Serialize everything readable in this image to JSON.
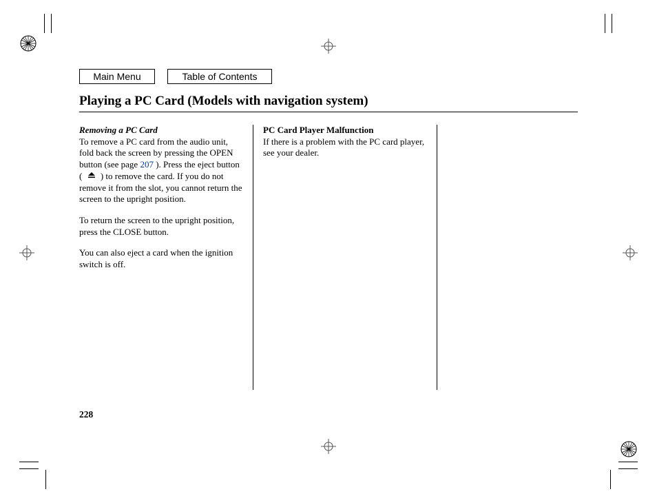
{
  "nav": {
    "main_menu": "Main Menu",
    "toc": "Table of Contents"
  },
  "title": "Playing a PC Card (Models with navigation system)",
  "col1": {
    "heading": "Removing a PC Card",
    "p1a": "To remove a PC card from the audio unit, fold back the screen by pressing the OPEN button (see page ",
    "page_link": "207",
    "p1b": " ). Press the eject button (",
    "p1c": ") to remove the card. If you do not remove it from the slot, you cannot return the screen to the upright position.",
    "p2": "To return the screen to the upright position, press the CLOSE button.",
    "p3": "You can also eject a card when the ignition switch is off."
  },
  "col2": {
    "heading": "PC Card Player Malfunction",
    "p1": "If there is a problem with the PC card player, see your dealer."
  },
  "page_number": "228"
}
